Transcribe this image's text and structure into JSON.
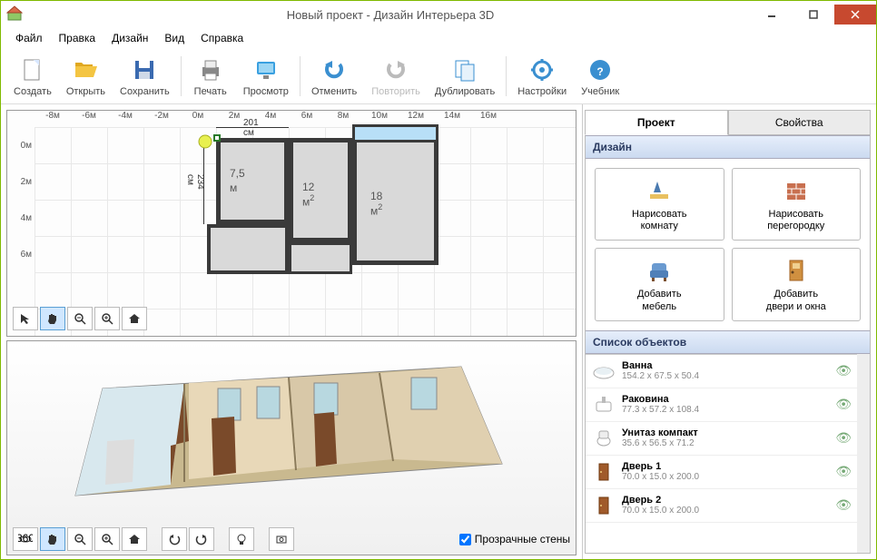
{
  "window": {
    "title": "Новый проект - Дизайн Интерьера 3D"
  },
  "menu": {
    "items": [
      "Файл",
      "Правка",
      "Дизайн",
      "Вид",
      "Справка"
    ]
  },
  "toolbar": {
    "create": "Создать",
    "open": "Открыть",
    "save": "Сохранить",
    "print": "Печать",
    "preview": "Просмотр",
    "undo": "Отменить",
    "redo": "Повторить",
    "duplicate": "Дублировать",
    "settings": "Настройки",
    "tutorial": "Учебник"
  },
  "rulers": {
    "h": [
      "-8м",
      "-6м",
      "-4м",
      "-2м",
      "0м",
      "2м",
      "4м",
      "6м",
      "8м",
      "10м",
      "12м",
      "14м",
      "16м"
    ],
    "v": [
      "0м",
      "2м",
      "4м",
      "6м"
    ]
  },
  "plan": {
    "dim_w": "201 см",
    "dim_h": "234 см",
    "r1": "7,5 м",
    "r2": "12 м",
    "r3": "18 м",
    "r2_sq": "2",
    "r3_sq": "2"
  },
  "view3d": {
    "transparent_walls": "Прозрачные стены"
  },
  "tabs": {
    "project": "Проект",
    "properties": "Свойства"
  },
  "sections": {
    "design": "Дизайн",
    "objects": "Список объектов"
  },
  "actions": {
    "draw_room": "Нарисовать\nкомнату",
    "draw_partition": "Нарисовать\nперегородку",
    "add_furniture": "Добавить\nмебель",
    "add_doors_windows": "Добавить\nдвери и окна"
  },
  "objects": [
    {
      "name": "Ванна",
      "dim": "154.2 x 67.5 x 50.4",
      "icon": "bath"
    },
    {
      "name": "Раковина",
      "dim": "77.3 x 57.2 x 108.4",
      "icon": "sink"
    },
    {
      "name": "Унитаз компакт",
      "dim": "35.6 x 56.5 x 71.2",
      "icon": "toilet"
    },
    {
      "name": "Дверь 1",
      "dim": "70.0 x 15.0 x 200.0",
      "icon": "door"
    },
    {
      "name": "Дверь 2",
      "dim": "70.0 x 15.0 x 200.0",
      "icon": "door"
    }
  ]
}
